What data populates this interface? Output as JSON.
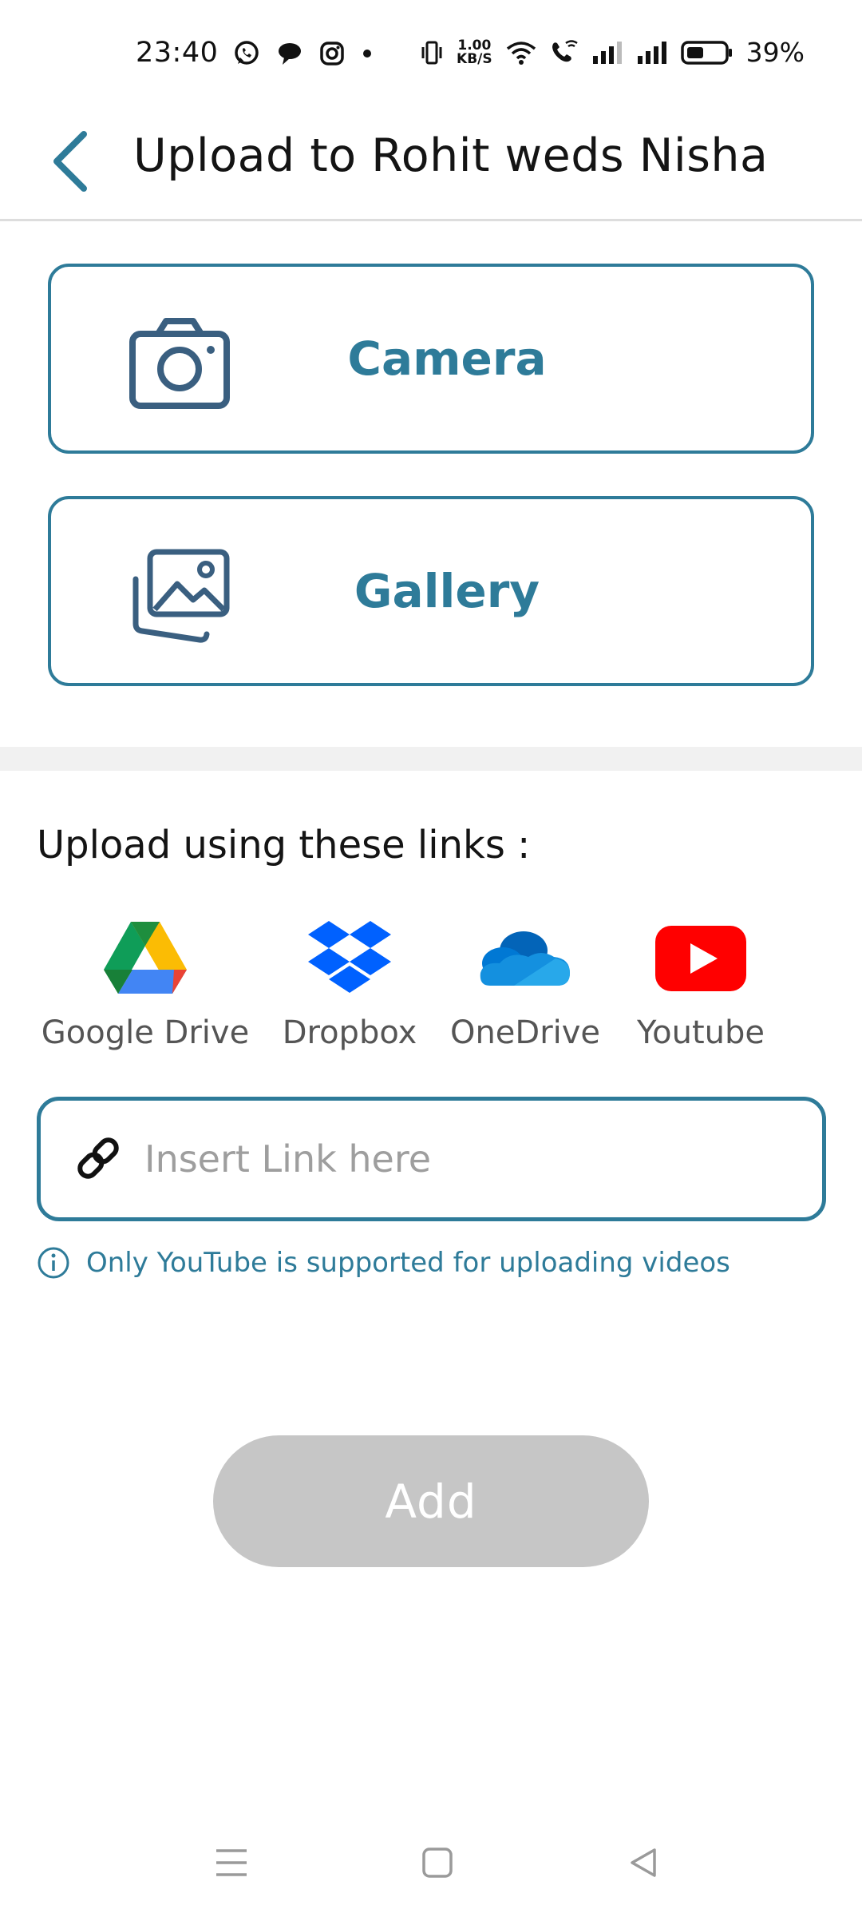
{
  "status_bar": {
    "time": "23:40",
    "net_speed_value": "1.00",
    "net_speed_unit": "KB/S",
    "battery_percent": "39%",
    "icons": [
      "whatsapp-icon",
      "chat-bubble-icon",
      "instagram-icon",
      "dot-icon",
      "vibrate-icon",
      "wifi-icon",
      "wifi-calling-icon",
      "signal-icon",
      "signal-icon",
      "battery-icon"
    ]
  },
  "header": {
    "title": "Upload to Rohit weds Nisha",
    "back_icon": "chevron-left-icon"
  },
  "options": [
    {
      "label": "Camera",
      "icon": "camera-icon"
    },
    {
      "label": "Gallery",
      "icon": "gallery-icon"
    }
  ],
  "links_section": {
    "heading": "Upload using these links :",
    "providers": [
      {
        "label": "Google Drive",
        "icon": "google-drive-icon"
      },
      {
        "label": "Dropbox",
        "icon": "dropbox-icon"
      },
      {
        "label": "OneDrive",
        "icon": "onedrive-icon"
      },
      {
        "label": "Youtube",
        "icon": "youtube-icon"
      }
    ],
    "input": {
      "placeholder": "Insert Link here",
      "value": ""
    },
    "note": "Only YouTube is supported for uploading videos"
  },
  "add_button": {
    "label": "Add"
  },
  "nav_bar": {
    "icons": [
      "menu-icon",
      "home-square-icon",
      "back-triangle-icon"
    ]
  },
  "colors": {
    "accent": "#2e7b99",
    "disabled_button": "#c6c6c6"
  }
}
